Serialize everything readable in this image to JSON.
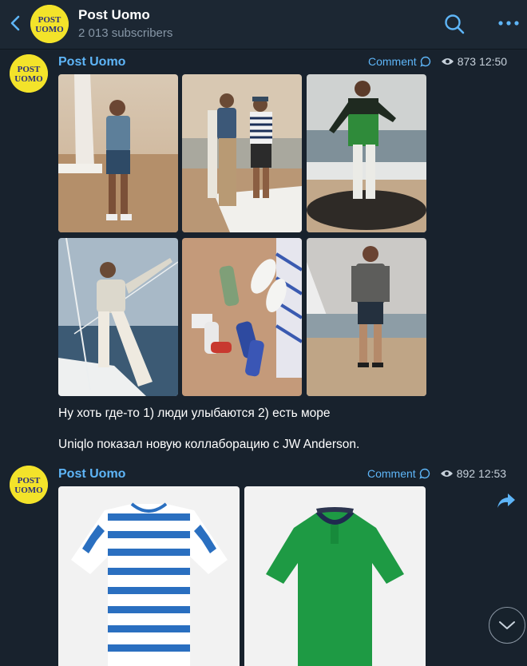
{
  "header": {
    "title": "Post Uomo",
    "subscribers": "2 013 subscribers",
    "logo_top": "POST",
    "logo_bottom": "UOMO"
  },
  "posts": [
    {
      "author": "Post Uomo",
      "comment_label": "Comment",
      "views": "873",
      "time": "12:50",
      "photos": [
        "man-on-beach-denim-shirt",
        "couple-on-boat-deck",
        "man-green-jacket-on-rock",
        "man-on-sailboat-white-outfit",
        "socks-and-sneakers-on-sand",
        "man-grey-shirt-beach"
      ],
      "caption_line1": "Ну хоть где-то 1) люди улыбаются 2) есть море",
      "caption_line2": "Uniqlo показал новую коллаборацию с JW Anderson."
    },
    {
      "author": "Post Uomo",
      "comment_label": "Comment",
      "views": "892",
      "time": "12:53",
      "photos": [
        "blue-white-striped-tshirt",
        "green-polo-shirt"
      ]
    }
  ],
  "colors": {
    "background": "#18222d",
    "accent": "#5eb5f7",
    "logo_yellow": "#f3e32a"
  }
}
